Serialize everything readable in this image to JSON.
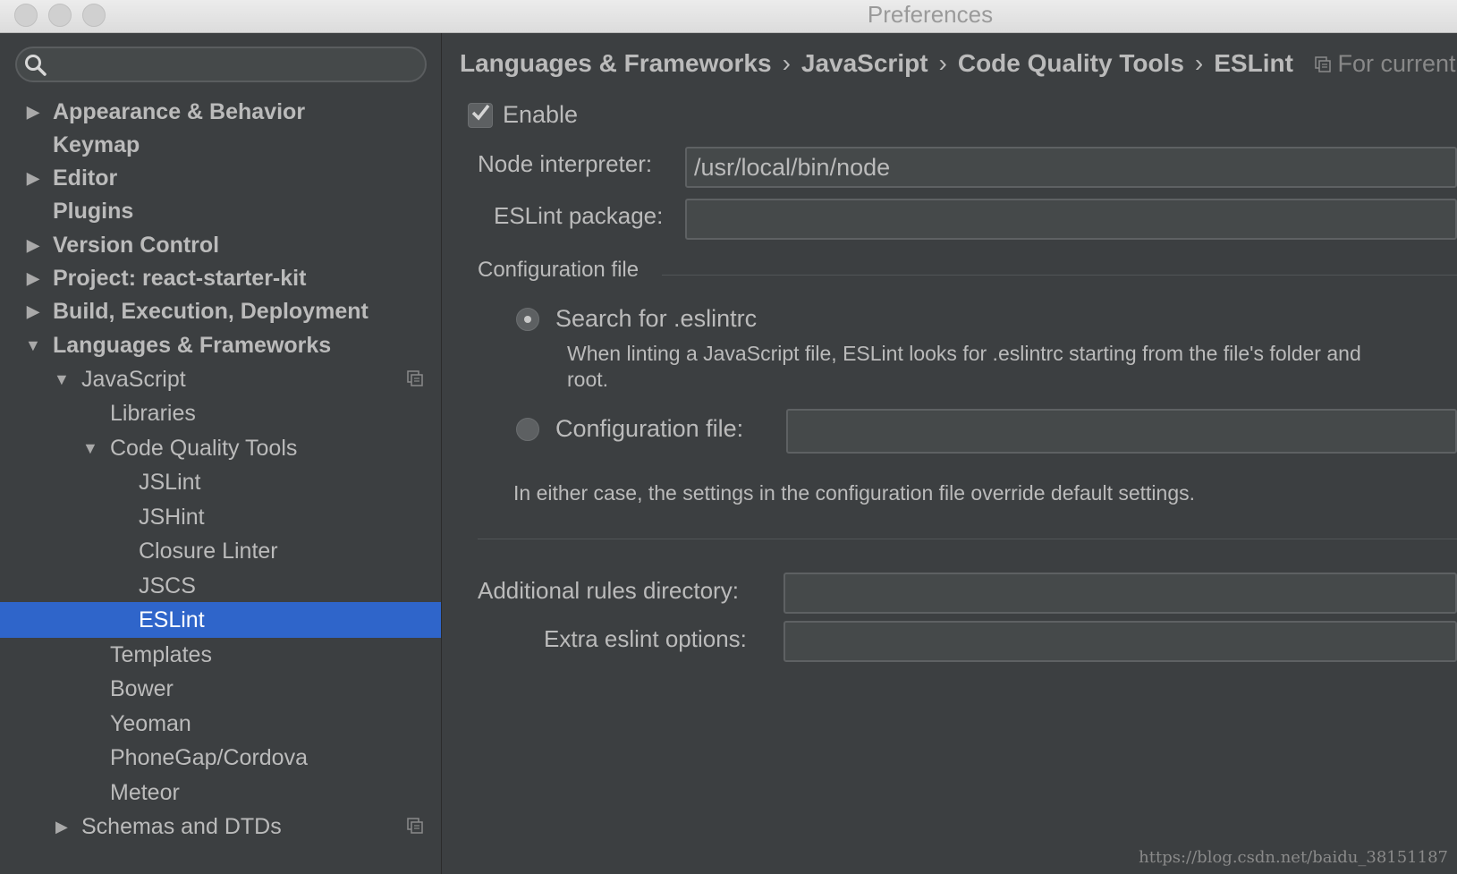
{
  "window": {
    "title": "Preferences"
  },
  "search": {
    "placeholder": ""
  },
  "tree": [
    {
      "label": "Appearance & Behavior",
      "bold": true
    },
    {
      "label": "Keymap",
      "bold": true
    },
    {
      "label": "Editor",
      "bold": true
    },
    {
      "label": "Plugins",
      "bold": true
    },
    {
      "label": "Version Control",
      "bold": true
    },
    {
      "label": "Project: react-starter-kit",
      "bold": true
    },
    {
      "label": "Build, Execution, Deployment",
      "bold": true
    },
    {
      "label": "Languages & Frameworks",
      "bold": true
    },
    {
      "label": "JavaScript",
      "bold": false
    },
    {
      "label": "Libraries",
      "bold": false
    },
    {
      "label": "Code Quality Tools",
      "bold": false
    },
    {
      "label": "JSLint",
      "bold": false
    },
    {
      "label": "JSHint",
      "bold": false
    },
    {
      "label": "Closure Linter",
      "bold": false
    },
    {
      "label": "JSCS",
      "bold": false
    },
    {
      "label": "ESLint",
      "bold": false,
      "selected": true
    },
    {
      "label": "Templates",
      "bold": false
    },
    {
      "label": "Bower",
      "bold": false
    },
    {
      "label": "Yeoman",
      "bold": false
    },
    {
      "label": "PhoneGap/Cordova",
      "bold": false
    },
    {
      "label": "Meteor",
      "bold": false
    },
    {
      "label": "Schemas and DTDs",
      "bold": false
    }
  ],
  "breadcrumb": {
    "items": [
      "Languages & Frameworks",
      "JavaScript",
      "Code Quality Tools",
      "ESLint"
    ],
    "separator": "›",
    "scope": "For current p"
  },
  "form": {
    "enable_label": "Enable",
    "enabled": true,
    "node_label": "Node interpreter:",
    "node_value": "/usr/local/bin/node",
    "package_label": "ESLint package:",
    "package_value": "",
    "config_section": "Configuration file",
    "search_option": "Search for .eslintrc",
    "search_desc_1": "When linting a JavaScript file, ESLint looks for .eslintrc starting from the file's folder and",
    "search_desc_2": "root.",
    "config_option": "Configuration file:",
    "config_value": "",
    "note": "In either case, the settings in the configuration file override default settings.",
    "rules_label": "Additional rules directory:",
    "rules_value": "",
    "extra_label": "Extra eslint options:",
    "extra_value": ""
  },
  "watermark": "https://blog.csdn.net/baidu_38151187",
  "colors": {
    "selection": "#2f65ca",
    "background": "#3c3f41"
  }
}
